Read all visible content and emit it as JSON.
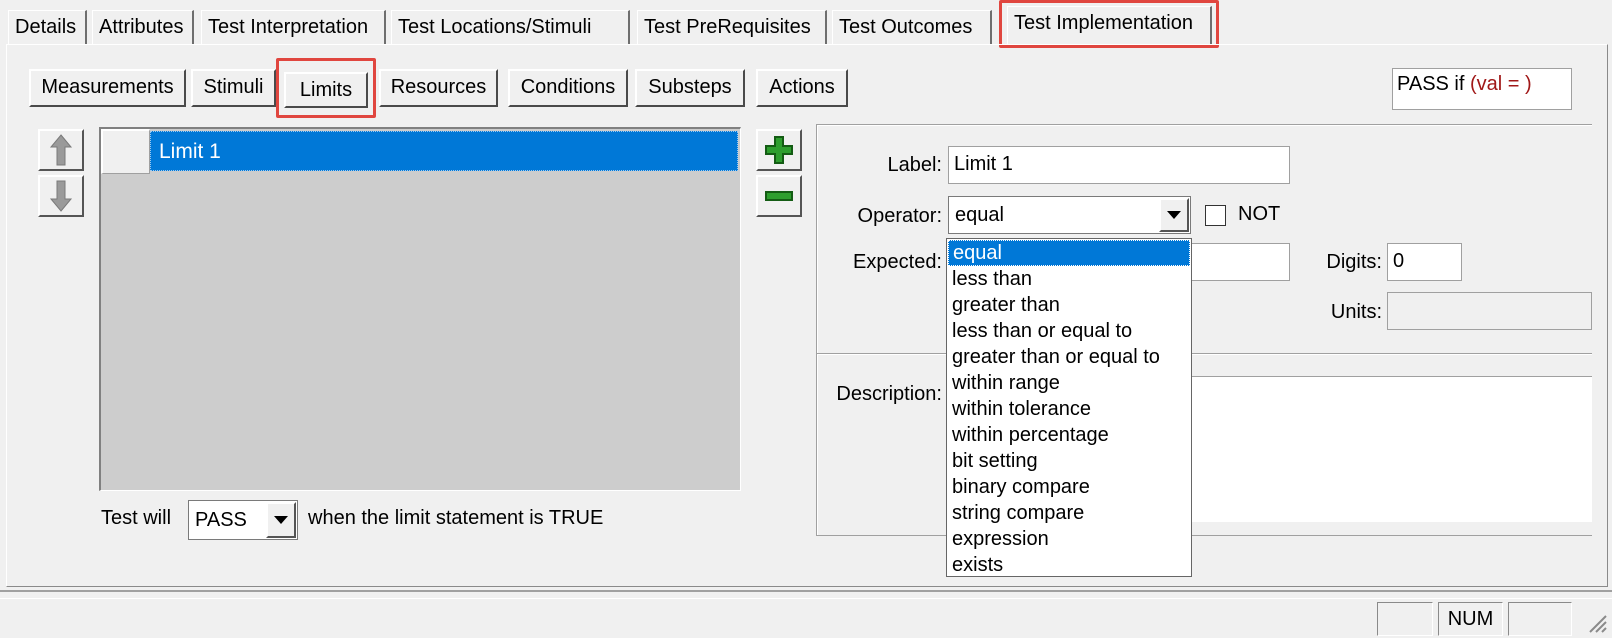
{
  "top_tabs": [
    {
      "label": "Details"
    },
    {
      "label": "Attributes"
    },
    {
      "label": "Test Interpretation"
    },
    {
      "label": "Test Locations/Stimuli"
    },
    {
      "label": "Test PreRequisites"
    },
    {
      "label": "Test Outcomes"
    },
    {
      "label": "Test Implementation"
    }
  ],
  "sub_tabs": [
    {
      "label": "Measurements"
    },
    {
      "label": "Stimuli"
    },
    {
      "label": "Limits"
    },
    {
      "label": "Resources"
    },
    {
      "label": "Conditions"
    },
    {
      "label": "Substeps"
    },
    {
      "label": "Actions"
    }
  ],
  "pass_summary": {
    "prefix": "PASS if ",
    "expr": "(val = )"
  },
  "limits_list": {
    "items": [
      {
        "label": "Limit 1"
      }
    ]
  },
  "test_will": {
    "prefix": "Test will",
    "selected": "PASS",
    "suffix": "when the limit statement is TRUE"
  },
  "form": {
    "label_label": "Label:",
    "label_value": "Limit 1",
    "operator_label": "Operator:",
    "operator_value": "equal",
    "not_label": "NOT",
    "not_checked": false,
    "expected_label": "Expected:",
    "expected_value": "",
    "digits_label": "Digits:",
    "digits_value": "0",
    "units_label": "Units:",
    "units_value": "",
    "description_label": "Description:",
    "description_value": ""
  },
  "operator_options": [
    "equal",
    "less than",
    "greater than",
    "less than or equal to",
    "greater than or equal to",
    "within range",
    "within tolerance",
    "within percentage",
    "bit setting",
    "binary compare",
    "string compare",
    "expression",
    "exists"
  ],
  "status_bar": {
    "num": "NUM"
  },
  "colors": {
    "selection": "#0078d7",
    "highlight": "#e0463f",
    "expr_red": "#a01818",
    "plus_green": "#2e9e2e"
  }
}
